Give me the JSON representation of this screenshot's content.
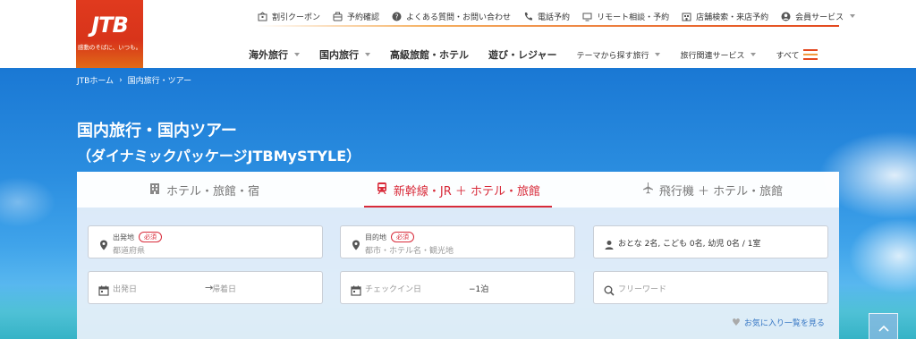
{
  "brand": {
    "logo": "JTB",
    "tagline": "感動のそばに、いつも。"
  },
  "utility_nav": [
    {
      "label": "割引クーポン",
      "icon": "coupon-icon"
    },
    {
      "label": "予約確認",
      "icon": "suitcase-icon"
    },
    {
      "label": "よくある質問・お問い合わせ",
      "icon": "question-icon"
    },
    {
      "label": "電話予約",
      "icon": "phone-icon"
    },
    {
      "label": "リモート相談・予約",
      "icon": "monitor-icon"
    },
    {
      "label": "店舗検索・来店予約",
      "icon": "store-icon"
    },
    {
      "label": "会員サービス",
      "icon": "user-icon"
    }
  ],
  "main_nav": [
    {
      "label": "海外旅行"
    },
    {
      "label": "国内旅行"
    },
    {
      "label": "高級旅館・ホテル"
    },
    {
      "label": "遊び・レジャー"
    },
    {
      "label": "テーマから探す旅行"
    },
    {
      "label": "旅行関連サービス"
    },
    {
      "label": "すべて"
    }
  ],
  "breadcrumb": {
    "home": "JTBホーム",
    "current": "国内旅行・ツアー",
    "separator": "›"
  },
  "hero": {
    "title": "国内旅行・国内ツアー",
    "subtitle": "（ダイナミックパッケージJTBMySTYLE）"
  },
  "tabs": [
    {
      "label": "ホテル・旅館・宿",
      "icon": "building-icon",
      "active": false
    },
    {
      "label": "新幹線・JR ＋ ホテル・旅館",
      "icon": "train-icon",
      "active": true
    },
    {
      "label": "飛行機 ＋ ホテル・旅館",
      "icon": "airplane-icon",
      "active": false
    }
  ],
  "form": {
    "departure": {
      "label": "出発地",
      "required": "必須",
      "placeholder": "都道府県"
    },
    "destination": {
      "label": "目的地",
      "required": "必須",
      "placeholder": "都市・ホテル名・観光地"
    },
    "guests": {
      "value": "おとな 2名, こども 0名, 幼児 0名 / 1室"
    },
    "depart_date": {
      "placeholder": "出発日"
    },
    "return_date": {
      "placeholder": "帰着日"
    },
    "checkin": {
      "placeholder": "チェックイン日",
      "nights": "−1泊"
    },
    "freeword": {
      "placeholder": "フリーワード"
    }
  },
  "favorites_link": "お気に入り一覧を見る",
  "colors": {
    "brand_red": "#d82b3a",
    "logo_red": "#e03a1e",
    "link_blue": "#3576c4"
  }
}
